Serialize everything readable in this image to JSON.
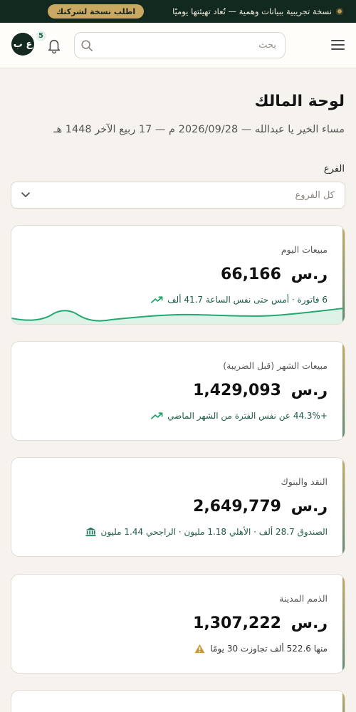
{
  "banner": {
    "message": "نسخة تجريبية ببيانات وهمية — تُعاد تهيئتها يوميًا",
    "cta": "اطلب نسخة لشركتك"
  },
  "header": {
    "search_placeholder": "بحث",
    "notifications_count": "5",
    "avatar_initials": "ع ب"
  },
  "page": {
    "title": "لوحة المالك",
    "greeting": "مساء الخير يا عبدالله — 2026/09/28 م — 17 ربيع الآخر 1448 هـ"
  },
  "filter": {
    "label": "الفرع",
    "selected": "كل الفروع"
  },
  "kpis": [
    {
      "title": "مبيعات اليوم",
      "value": "66,166",
      "currency": "ر.س",
      "sub": "6 فاتورة · أمس حتى نفس الساعة 41.7 ألف",
      "sub_icon": "trend-up-icon"
    },
    {
      "title": "مبيعات الشهر (قبل الضريبة)",
      "value": "1,429,093",
      "currency": "ر.س",
      "sub": "+44.3% عن نفس الفترة من الشهر الماضي",
      "sub_icon": "trend-up-icon"
    },
    {
      "title": "النقد والبنوك",
      "value": "2,649,779",
      "currency": "ر.س",
      "sub": "الصندوق 28.7 ألف · الأهلي 1.18 مليون · الراجحي 1.44 مليون",
      "sub_icon": "bank-icon"
    },
    {
      "title": "الذمم المدينة",
      "value": "1,307,222",
      "currency": "ر.س",
      "sub": "منها 522.6 ألف تجاوزت 30 يومًا",
      "sub_icon": "warning-icon"
    }
  ],
  "colors": {
    "banner_bg": "#12291f",
    "accent_gold": "#c9a861",
    "accent_green": "#1f9f6a",
    "warning": "#c79a3a"
  }
}
